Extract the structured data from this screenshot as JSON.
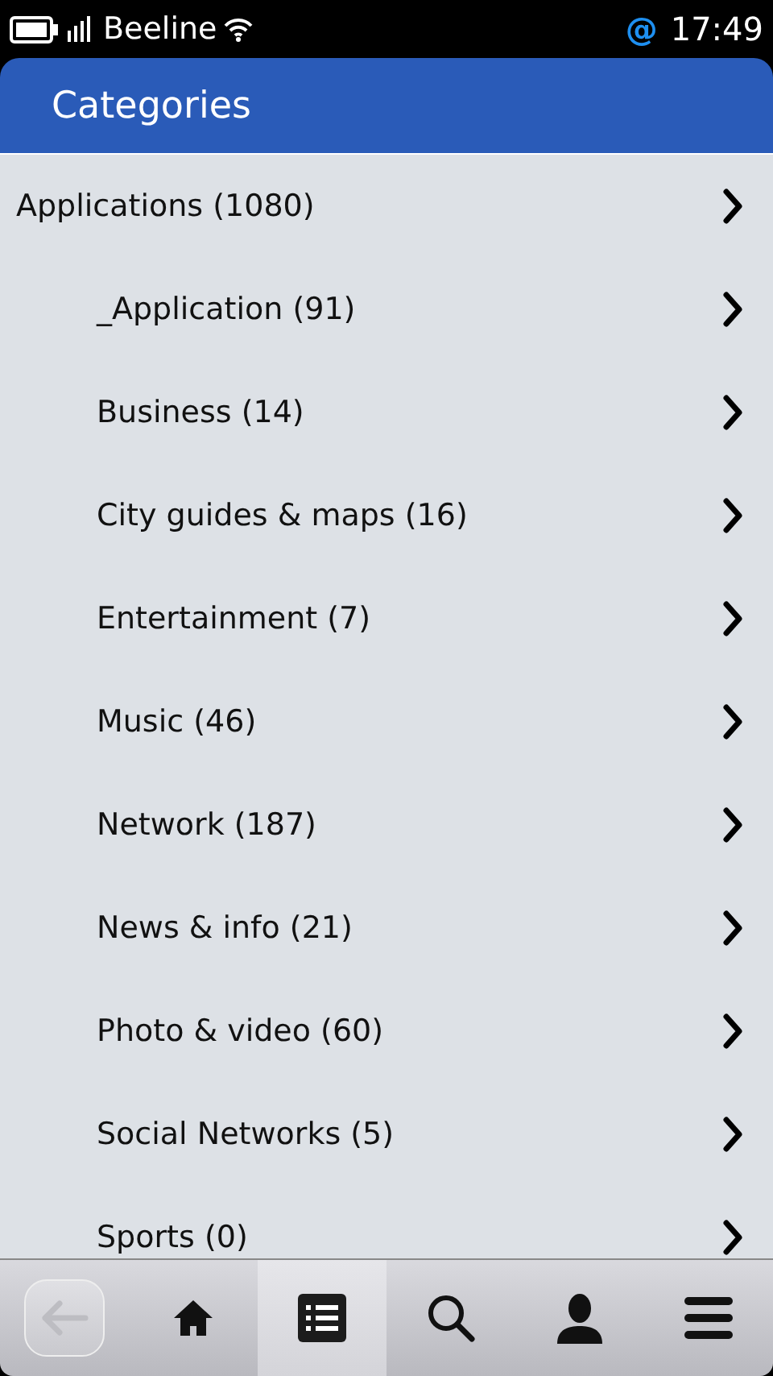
{
  "status_bar": {
    "carrier": "Beeline",
    "time": "17:49",
    "mail_glyph": "@"
  },
  "header": {
    "title": "Categories"
  },
  "categories": [
    {
      "label": "Applications (1080)",
      "children": [
        {
          "label": "_Application (91)"
        },
        {
          "label": "Business (14)"
        },
        {
          "label": "City guides & maps (16)"
        },
        {
          "label": "Entertainment (7)"
        },
        {
          "label": "Music (46)"
        },
        {
          "label": "Network (187)"
        },
        {
          "label": "News & info (21)"
        },
        {
          "label": "Photo & video (60)"
        },
        {
          "label": "Social Networks (5)"
        },
        {
          "label": "Sports (0)"
        }
      ]
    }
  ],
  "toolbar": {
    "back_disabled": true,
    "tabs": [
      {
        "kind": "home",
        "selected": false
      },
      {
        "kind": "list",
        "selected": true
      },
      {
        "kind": "search",
        "selected": false
      },
      {
        "kind": "profile",
        "selected": false
      },
      {
        "kind": "menu",
        "selected": false
      }
    ]
  }
}
